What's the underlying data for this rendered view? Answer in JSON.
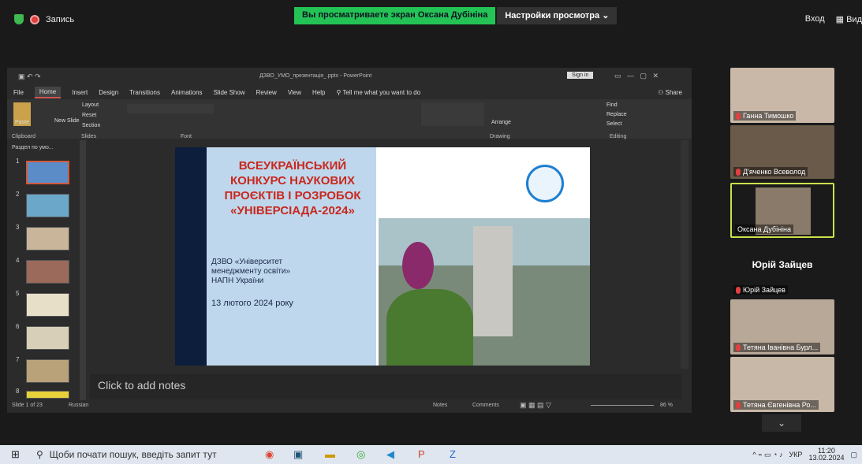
{
  "zoom": {
    "recording_label": "Запись",
    "banner_text": "Вы просматриваете экран Оксана Дубініна",
    "view_options_label": "Настройки просмотра",
    "login_label": "Вход",
    "view_label": "Вид"
  },
  "powerpoint": {
    "window_title": "ДЗВО_УМО_презентація_.pptx - PowerPoint",
    "sign_in_label": "Sign in",
    "share_label": "Share",
    "tabs": [
      "File",
      "Home",
      "Insert",
      "Design",
      "Transitions",
      "Animations",
      "Slide Show",
      "Review",
      "View",
      "Help"
    ],
    "tell_me": "Tell me what you want to do",
    "ribbon_groups": [
      "Clipboard",
      "Slides",
      "Font",
      "Drawing",
      "Editing"
    ],
    "ribbon_labels": {
      "paste": "Paste",
      "new_slide": "New Slide",
      "layout": "Layout",
      "reset": "Reset",
      "section": "Section",
      "arrange": "Arrange",
      "find": "Find",
      "replace": "Replace",
      "select": "Select"
    },
    "section_label": "Раздел по умо...",
    "thumb_numbers": [
      "1",
      "2",
      "3",
      "4",
      "5",
      "6",
      "7",
      "8"
    ],
    "slide": {
      "title_lines": [
        "ВСЕУКРАЇНСЬКИЙ",
        "КОНКУРС НАУКОВИХ",
        "ПРОЄКТІВ І РОЗРОБОК",
        "«УНІВЕРСІАДА-2024»"
      ],
      "org_lines": [
        "ДЗВО «Університет",
        "менеджменту освіти»",
        "НАПН України"
      ],
      "date": "13 лютого 2024 року"
    },
    "notes_placeholder": "Click to add notes",
    "status_left": "Slide 1 of 23",
    "status_lang": "Russian",
    "status_notes": "Notes",
    "status_comments": "Comments",
    "zoom_level": "86 %"
  },
  "participants": [
    {
      "name": "Ганна Тимошко",
      "muted": true,
      "tile_color": "#c9b8a8"
    },
    {
      "name": "Д'яченко Всеволод",
      "muted": true,
      "tile_color": "#6a5a4a"
    },
    {
      "name": "Оксана Дубініна",
      "muted": false,
      "tile_color": "#8a7a6a"
    },
    {
      "name": "Юрій Зайцев",
      "muted": true,
      "tile_color": "#1a1a1a"
    },
    {
      "name": "Тетяна Іванівна Бурл...",
      "muted": true,
      "tile_color": "#b8a898"
    },
    {
      "name": "Тетяна Євгенівна Ро...",
      "muted": true,
      "tile_color": "#c8b8a8"
    }
  ],
  "gallery_big_name": "Юрій Зайцев",
  "taskbar": {
    "search_placeholder": "Щоби почати пошук, введіть запит тут",
    "lang": "УКР",
    "time": "11:20",
    "date": "13.02.2024"
  }
}
